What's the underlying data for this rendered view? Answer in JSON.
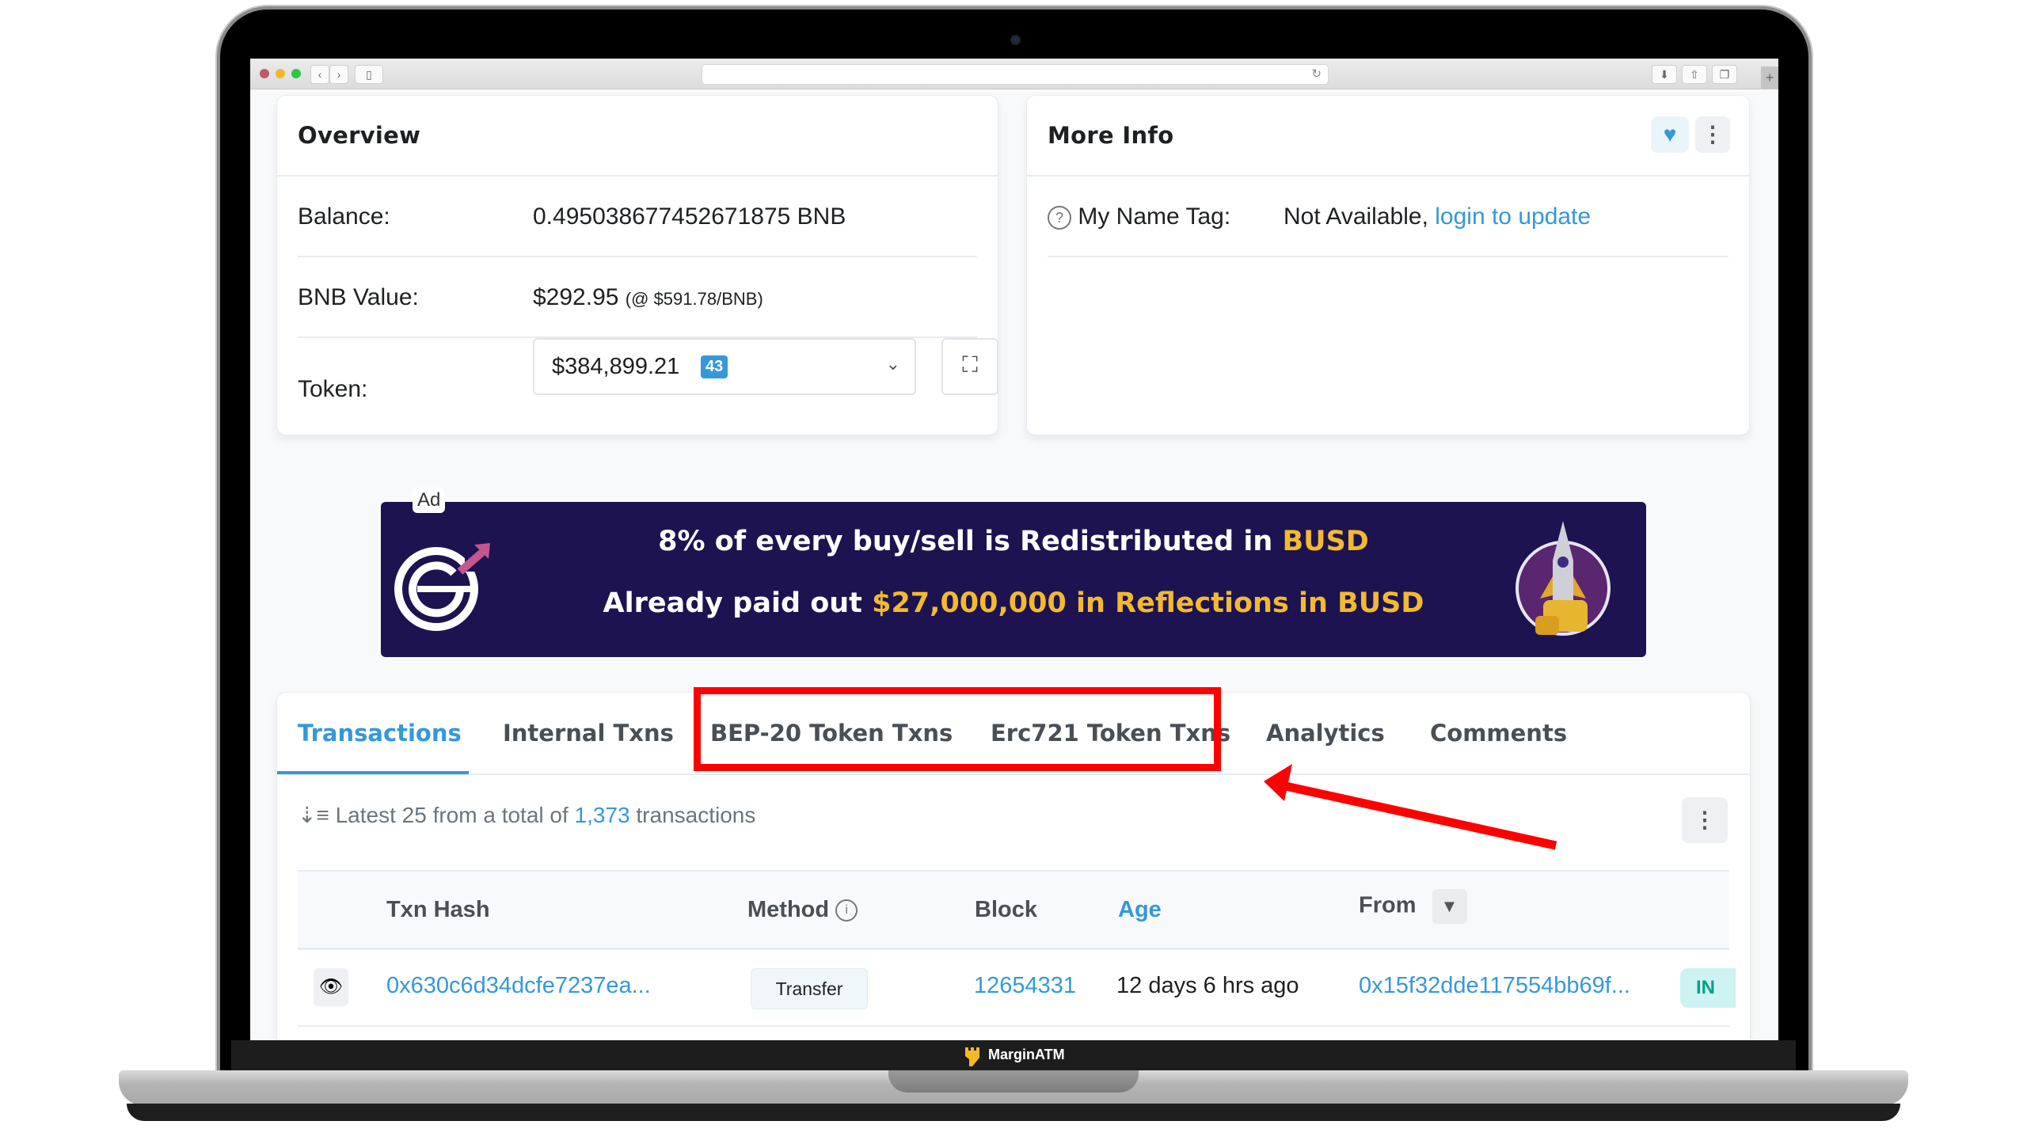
{
  "browser": {
    "back_icon": "‹",
    "forward_icon": "›",
    "reload_icon": "↻",
    "new_tab_icon": "+"
  },
  "overview": {
    "title": "Overview",
    "balance_label": "Balance:",
    "balance_value": "0.495038677452671875 BNB",
    "bnb_value_label": "BNB Value:",
    "bnb_value": "$292.95",
    "bnb_rate": "(@ $591.78/BNB)",
    "token_label": "Token:",
    "token_amount": "$384,899.21",
    "token_count": "43"
  },
  "more_info": {
    "title": "More Info",
    "name_tag_label": "My Name Tag:",
    "name_tag_value": "Not Available,",
    "login_link": "login to update"
  },
  "ad": {
    "label": "Ad",
    "line1_prefix": "8% of every buy/sell is Redistributed in ",
    "line1_highlight": "BUSD",
    "line2_prefix": "Already paid out ",
    "line2_highlight": "$27,000,000 in Reflections in BUSD",
    "colors": {
      "background": "#1d1350",
      "highlight": "#f3ba2f",
      "arrow": "#c0578f"
    }
  },
  "tabs": [
    {
      "label": "Transactions",
      "active": true
    },
    {
      "label": "Internal Txns",
      "active": false
    },
    {
      "label": "BEP-20 Token Txns",
      "active": false
    },
    {
      "label": "Erc721 Token Txns",
      "active": false
    },
    {
      "label": "Analytics",
      "active": false
    },
    {
      "label": "Comments",
      "active": false
    }
  ],
  "summary": {
    "prefix": "Latest 25 from a total of ",
    "count": "1,373",
    "suffix": " transactions"
  },
  "table": {
    "columns": [
      "Txn Hash",
      "Method",
      "Block",
      "Age",
      "From"
    ],
    "rows": [
      {
        "txn_hash": "0x630c6d34dcfe7237ea...",
        "method": "Transfer",
        "block": "12654331",
        "age": "12 days 6 hrs ago",
        "from": "0x15f32dde117554bb69f...",
        "direction": "IN"
      }
    ]
  },
  "footer": {
    "brand": "MarginATM"
  },
  "colors": {
    "accent": "#3498db",
    "highlight_box": "#ff0000"
  }
}
